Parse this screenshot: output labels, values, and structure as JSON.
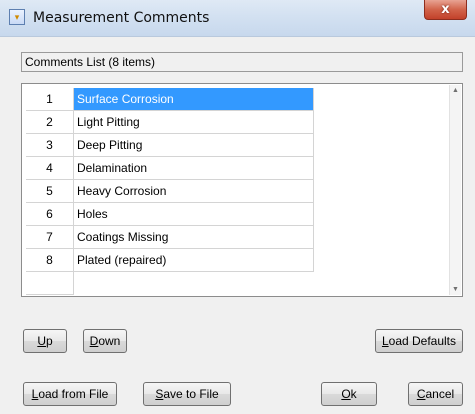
{
  "window": {
    "title": "Measurement Comments",
    "close_glyph": "x"
  },
  "list": {
    "label": "Comments List (8 items)",
    "rows": [
      {
        "num": "1",
        "text": "Surface Corrosion",
        "selected": true
      },
      {
        "num": "2",
        "text": "Light Pitting",
        "selected": false
      },
      {
        "num": "3",
        "text": "Deep Pitting",
        "selected": false
      },
      {
        "num": "4",
        "text": "Delamination",
        "selected": false
      },
      {
        "num": "5",
        "text": "Heavy Corrosion",
        "selected": false
      },
      {
        "num": "6",
        "text": "Holes",
        "selected": false
      },
      {
        "num": "7",
        "text": "Coatings Missing",
        "selected": false
      },
      {
        "num": "8",
        "text": "Plated (repaired)",
        "selected": false
      }
    ]
  },
  "buttons": {
    "up": {
      "access": "U",
      "rest": "p"
    },
    "down": {
      "access": "D",
      "rest": "own"
    },
    "load_defaults": {
      "access": "L",
      "rest": "oad Defaults"
    },
    "load_from_file": {
      "access": "L",
      "rest": "oad from File"
    },
    "save_to_file": {
      "access": "S",
      "rest": "ave to File"
    },
    "ok": {
      "access": "O",
      "rest": "k"
    },
    "cancel": {
      "access": "C",
      "rest": "ancel"
    }
  },
  "colors": {
    "selection": "#3399ff",
    "window_bg": "#f0f0f0",
    "close_button": "#c7432c"
  },
  "icons": {
    "app": "app-dialog-icon",
    "scroll_up": "arrow-up-icon",
    "scroll_down": "arrow-down-icon"
  }
}
